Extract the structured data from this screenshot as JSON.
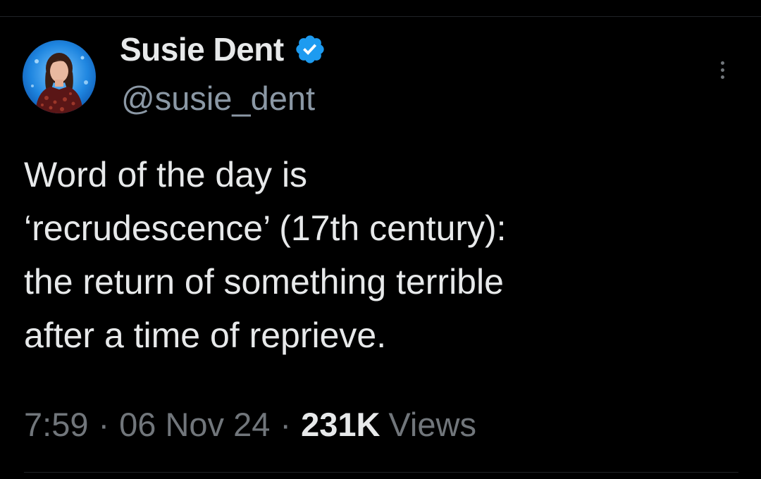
{
  "tweet": {
    "author": {
      "display_name": "Susie Dent",
      "handle": "@susie_dent",
      "verified": true,
      "verified_icon": "verified-badge-icon",
      "avatar": "profile-photo"
    },
    "text_lines": [
      "Word of the day is",
      "‘recrudescence’ (17th century):",
      "the return of something terrible",
      "after a time of reprieve."
    ],
    "time": "7:59",
    "separator": "·",
    "date": "06 Nov 24",
    "views_count": "231K",
    "views_label": "Views",
    "more_icon": "more-options-icon"
  },
  "colors": {
    "background": "#000000",
    "primary_text": "#e7e9ea",
    "secondary_text": "#71767b",
    "verified_blue": "#1d9bf0",
    "divider": "#202327"
  }
}
